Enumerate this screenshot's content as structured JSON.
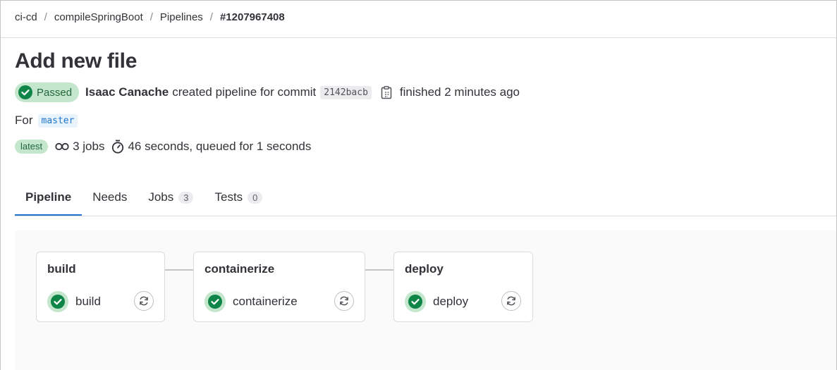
{
  "breadcrumb": {
    "items": [
      "ci-cd",
      "compileSpringBoot",
      "Pipelines"
    ],
    "current": "#1207967408",
    "separator": "/"
  },
  "page": {
    "title": "Add new file"
  },
  "status": {
    "badge_label": "Passed",
    "author": "Isaac Canache",
    "text": "created pipeline for commit",
    "commit_sha": "2142bacb",
    "finished_text": "finished 2 minutes ago"
  },
  "ref": {
    "prefix": "For",
    "branch": "master"
  },
  "meta": {
    "latest_label": "latest",
    "jobs_text": "3 jobs",
    "duration_text": "46 seconds, queued for 1 seconds"
  },
  "tabs": [
    {
      "label": "Pipeline",
      "count": null
    },
    {
      "label": "Needs",
      "count": null
    },
    {
      "label": "Jobs",
      "count": "3"
    },
    {
      "label": "Tests",
      "count": "0"
    }
  ],
  "stages": [
    {
      "name": "build",
      "job": "build",
      "status": "success"
    },
    {
      "name": "containerize",
      "job": "containerize",
      "status": "success"
    },
    {
      "name": "deploy",
      "job": "deploy",
      "status": "success"
    }
  ],
  "colors": {
    "success": "#108548",
    "success_bg": "#c3e6cd",
    "link": "#1f75cb",
    "text": "#333238"
  },
  "icons": {
    "status": "status-success-icon",
    "copy": "clipboard-icon",
    "jobs": "pipeline-jobs-icon",
    "duration": "timer-icon",
    "retry": "retry-icon"
  }
}
